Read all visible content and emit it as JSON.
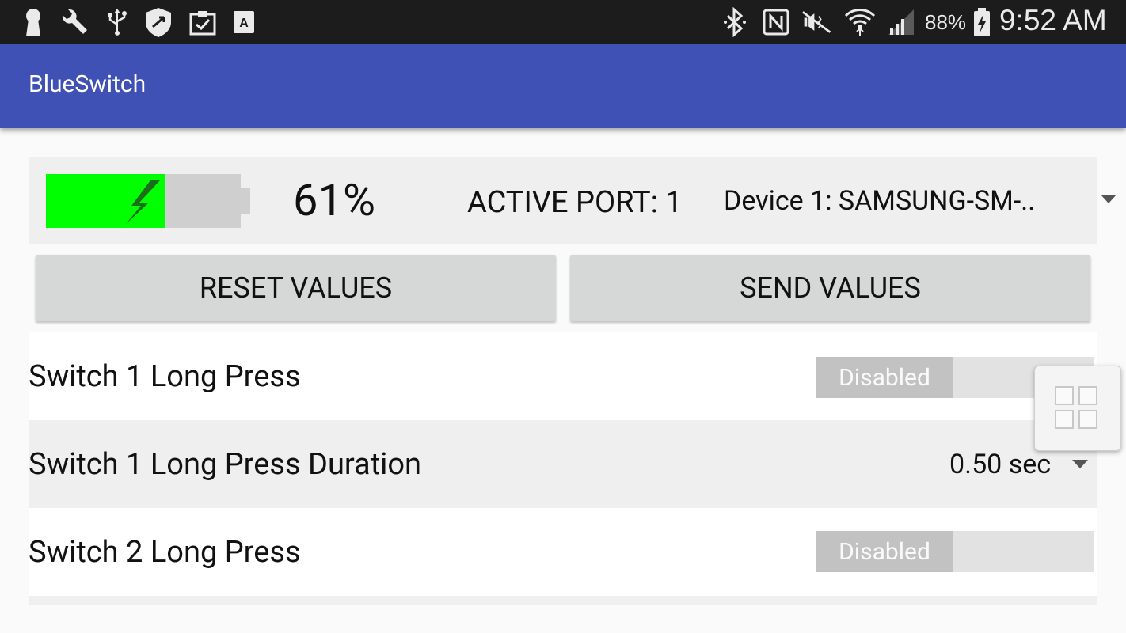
{
  "status_bar": {
    "battery_percent_text": "88%",
    "time": "9:52 AM",
    "left_icons": [
      "keyhole-icon",
      "wrench-icon",
      "usb-icon",
      "shield-icon",
      "clipboard-check-icon",
      "font-a-icon"
    ],
    "right_icons": [
      "bluetooth-icon",
      "nfc-icon",
      "mute-icon",
      "wifi-icon",
      "signal-icon",
      "battery-charging-icon"
    ]
  },
  "app_bar": {
    "title": "BlueSwitch"
  },
  "header": {
    "battery_level": 0.61,
    "battery_text": "61%",
    "active_port": "ACTIVE PORT: 1",
    "device": "Device 1: SAMSUNG-SM-.."
  },
  "buttons": {
    "reset": "RESET VALUES",
    "send": "SEND VALUES"
  },
  "settings": [
    {
      "label": "Switch 1 Long Press",
      "type": "toggle",
      "value": "Disabled"
    },
    {
      "label": "Switch 1 Long Press Duration",
      "type": "select",
      "value": "0.50 sec"
    },
    {
      "label": "Switch 2 Long Press",
      "type": "toggle",
      "value": "Disabled"
    }
  ],
  "colors": {
    "app_bar": "#3f51b5",
    "battery_fill": "#00ff00",
    "status_bar": "#1c1c1c",
    "button_bg": "#d6d7d7"
  }
}
